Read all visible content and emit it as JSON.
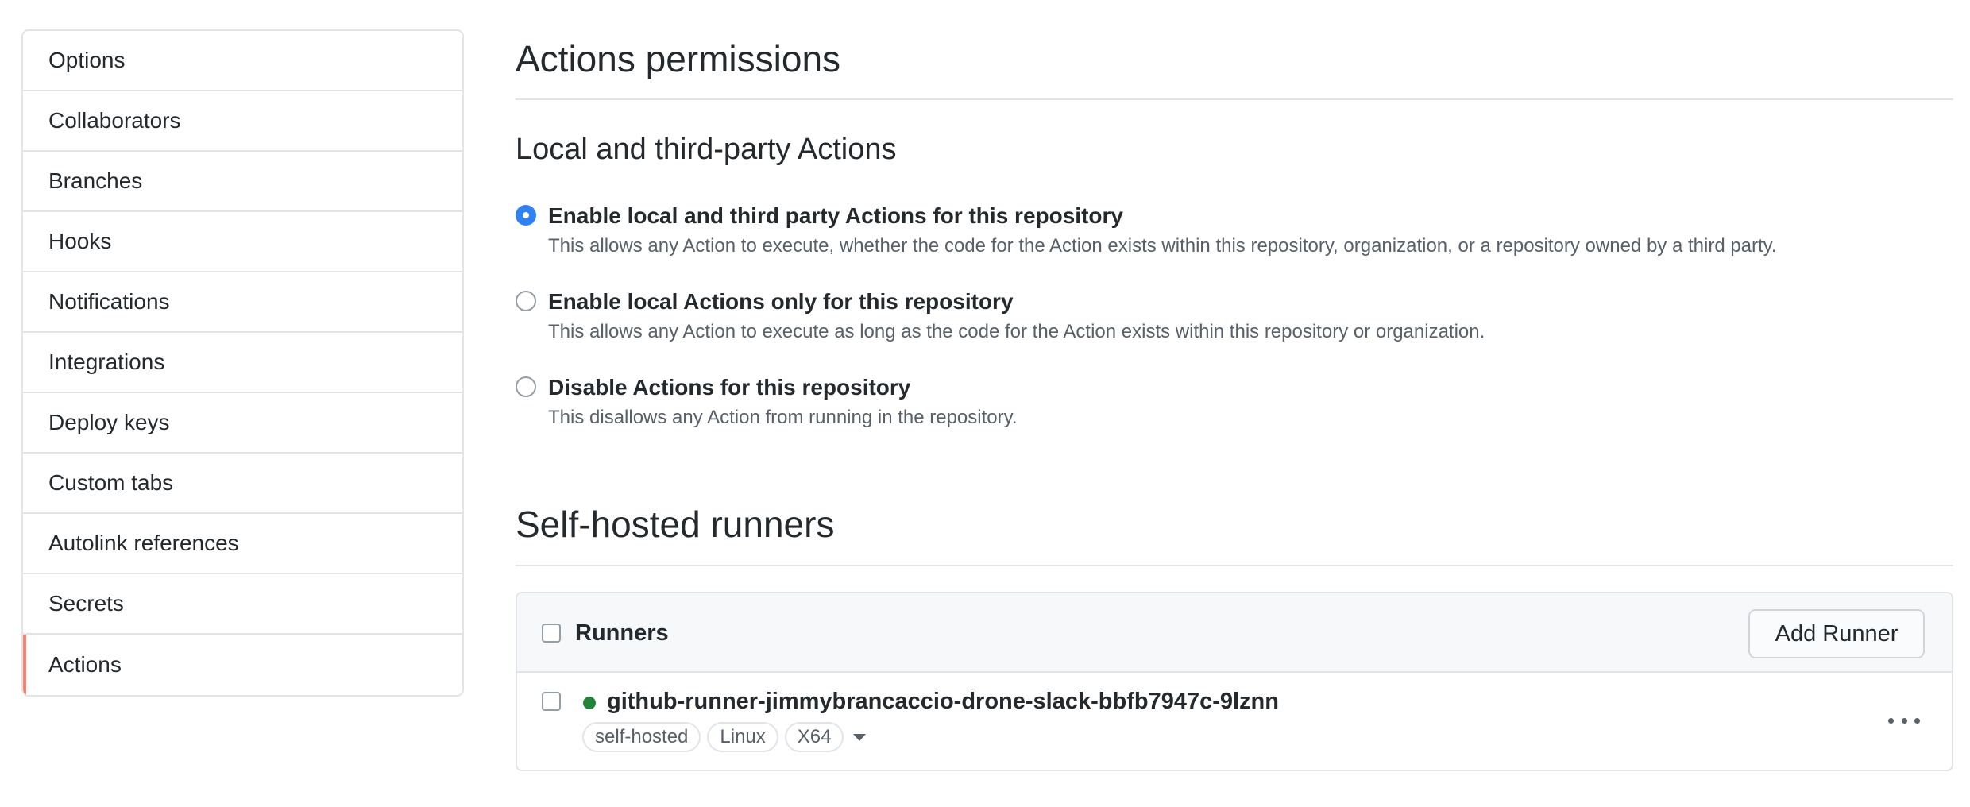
{
  "sidebar": {
    "items": [
      {
        "label": "Options"
      },
      {
        "label": "Collaborators"
      },
      {
        "label": "Branches"
      },
      {
        "label": "Hooks"
      },
      {
        "label": "Notifications"
      },
      {
        "label": "Integrations"
      },
      {
        "label": "Deploy keys"
      },
      {
        "label": "Custom tabs"
      },
      {
        "label": "Autolink references"
      },
      {
        "label": "Secrets"
      },
      {
        "label": "Actions"
      }
    ],
    "selected": "Actions"
  },
  "permissions": {
    "title": "Actions permissions",
    "subtitle": "Local and third-party Actions",
    "options": [
      {
        "label": "Enable local and third party Actions for this repository",
        "note": "This allows any Action to execute, whether the code for the Action exists within this repository, organization, or a repository owned by a third party.",
        "checked": true
      },
      {
        "label": "Enable local Actions only for this repository",
        "note": "This allows any Action to execute as long as the code for the Action exists within this repository or organization.",
        "checked": false
      },
      {
        "label": "Disable Actions for this repository",
        "note": "This disallows any Action from running in the repository.",
        "checked": false
      }
    ]
  },
  "runners": {
    "title": "Self-hosted runners",
    "header_label": "Runners",
    "add_button": "Add Runner",
    "items": [
      {
        "name": "github-runner-jimmybrancaccio-drone-slack-bbfb7947c-9lznn",
        "status_color": "#22863a",
        "labels": [
          "self-hosted",
          "Linux",
          "X64"
        ]
      }
    ]
  },
  "colors": {
    "accent": "#2f81f7",
    "selected_marker": "#f9826c",
    "status_online": "#22863a"
  }
}
